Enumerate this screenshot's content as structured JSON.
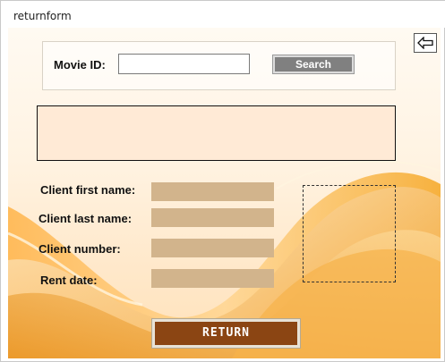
{
  "window": {
    "title": "returnform"
  },
  "search": {
    "movie_id_label": "Movie ID:",
    "movie_id_value": "",
    "search_label": "Search"
  },
  "back": {
    "icon": "arrow-left-icon"
  },
  "fields": [
    {
      "label": "Client first name:",
      "value": ""
    },
    {
      "label": "Client last name:",
      "value": ""
    },
    {
      "label": "Client number:",
      "value": ""
    },
    {
      "label": "Rent date:",
      "value": ""
    }
  ],
  "return_button": {
    "label": "RETURN"
  },
  "colors": {
    "field_bg": "#d2b48c",
    "return_bg": "#8b4513",
    "search_bg": "#808080",
    "result_bg": "#ffead6"
  }
}
